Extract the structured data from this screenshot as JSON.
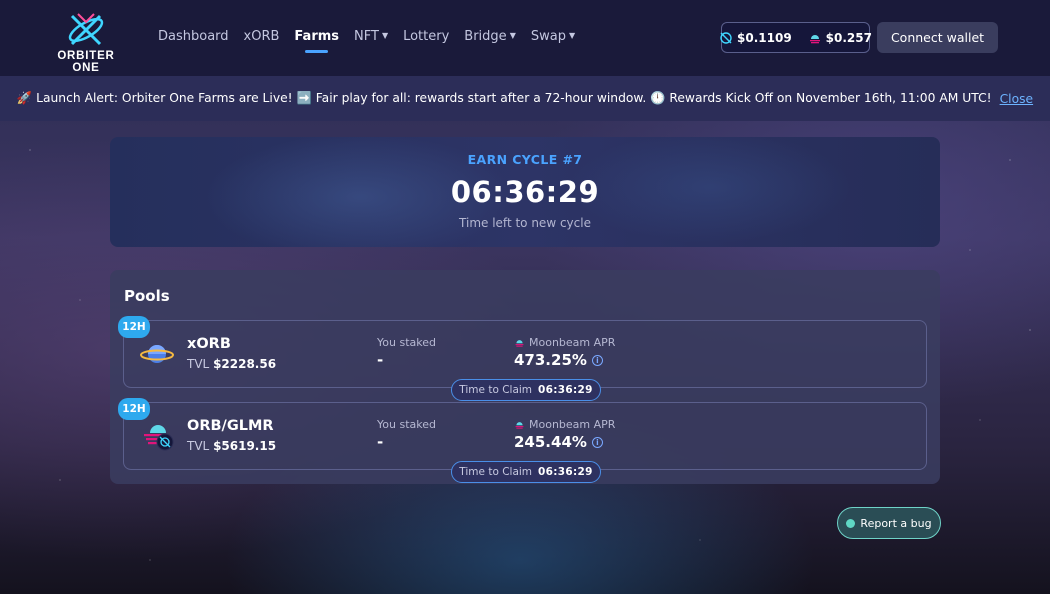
{
  "header": {
    "logo_text": "ORBITER ONE",
    "nav": [
      {
        "label": "Dashboard",
        "active": false,
        "dropdown": false
      },
      {
        "label": "xORB",
        "active": false,
        "dropdown": false
      },
      {
        "label": "Farms",
        "active": true,
        "dropdown": false
      },
      {
        "label": "NFT",
        "active": false,
        "dropdown": true
      },
      {
        "label": "Lottery",
        "active": false,
        "dropdown": false
      },
      {
        "label": "Bridge",
        "active": false,
        "dropdown": true
      },
      {
        "label": "Swap",
        "active": false,
        "dropdown": true
      }
    ],
    "prices": [
      {
        "icon": "orb-token-icon",
        "value": "$0.1109"
      },
      {
        "icon": "moonbeam-icon",
        "value": "$0.257"
      }
    ],
    "connect_label": "Connect wallet"
  },
  "announcement": {
    "text": "🚀 Launch Alert: Orbiter One Farms are Live! ➡️ Fair play for all: rewards start after a 72-hour window. 🕛 Rewards Kick Off on November 16th, 11:00 AM UTC!",
    "close_label": "Close"
  },
  "cycle": {
    "label": "EARN CYCLE #7",
    "time": "06:36:29",
    "subtitle": "Time left to new cycle"
  },
  "pools": {
    "title": "Pools",
    "items": [
      {
        "badge": "12H",
        "icon": "xorb-planet-icon",
        "name": "xORB",
        "tvl_label": "TVL",
        "tvl_value": "$2228.56",
        "staked_label": "You staked",
        "staked_value": "-",
        "apr_label": "Moonbeam APR",
        "apr_value": "473.25%",
        "claim_label": "Time to Claim",
        "claim_time": "06:36:29"
      },
      {
        "badge": "12H",
        "icon": "orb-glmr-pair-icon",
        "name": "ORB/GLMR",
        "tvl_label": "TVL",
        "tvl_value": "$5619.15",
        "staked_label": "You staked",
        "staked_value": "-",
        "apr_label": "Moonbeam APR",
        "apr_value": "245.44%",
        "claim_label": "Time to Claim",
        "claim_time": "06:36:29"
      }
    ]
  },
  "report_bug_label": "Report a bug",
  "colors": {
    "accent": "#4aa3ff",
    "header_bg": "#1a1a3a",
    "badge": "#2ea9ee",
    "bug_button": "#2a4d55"
  }
}
